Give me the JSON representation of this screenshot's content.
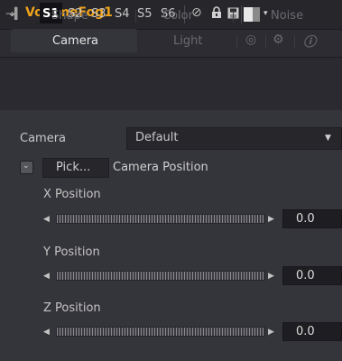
{
  "header": {
    "title": "VolumeFog1",
    "collapse_icon": "chevron-down-icon"
  },
  "toolbar": {
    "pin_icon": "pin-icon",
    "slots": [
      "S1",
      "S2",
      "S3",
      "S4",
      "S5",
      "S6"
    ],
    "active_slot": "S1",
    "icons": [
      "disable-icon",
      "lock-icon",
      "save-icon",
      "color-swatch-icon"
    ]
  },
  "tabs": {
    "row1": [
      "Shape",
      "Color",
      "Noise"
    ],
    "row2": [
      "Camera",
      "Light"
    ],
    "active": "Camera",
    "row2_icons": [
      "settings-icon",
      "gear-icon",
      "info-icon"
    ]
  },
  "camera": {
    "label": "Camera",
    "selected": "Default"
  },
  "pick": {
    "button": "Pick...",
    "label": "Camera Position"
  },
  "positions": [
    {
      "label": "X Position",
      "value": "0.0"
    },
    {
      "label": "Y Position",
      "value": "0.0"
    },
    {
      "label": "Z Position",
      "value": "0.0"
    }
  ],
  "colors": {
    "title": "#f0a31a",
    "background": "#34343b"
  }
}
